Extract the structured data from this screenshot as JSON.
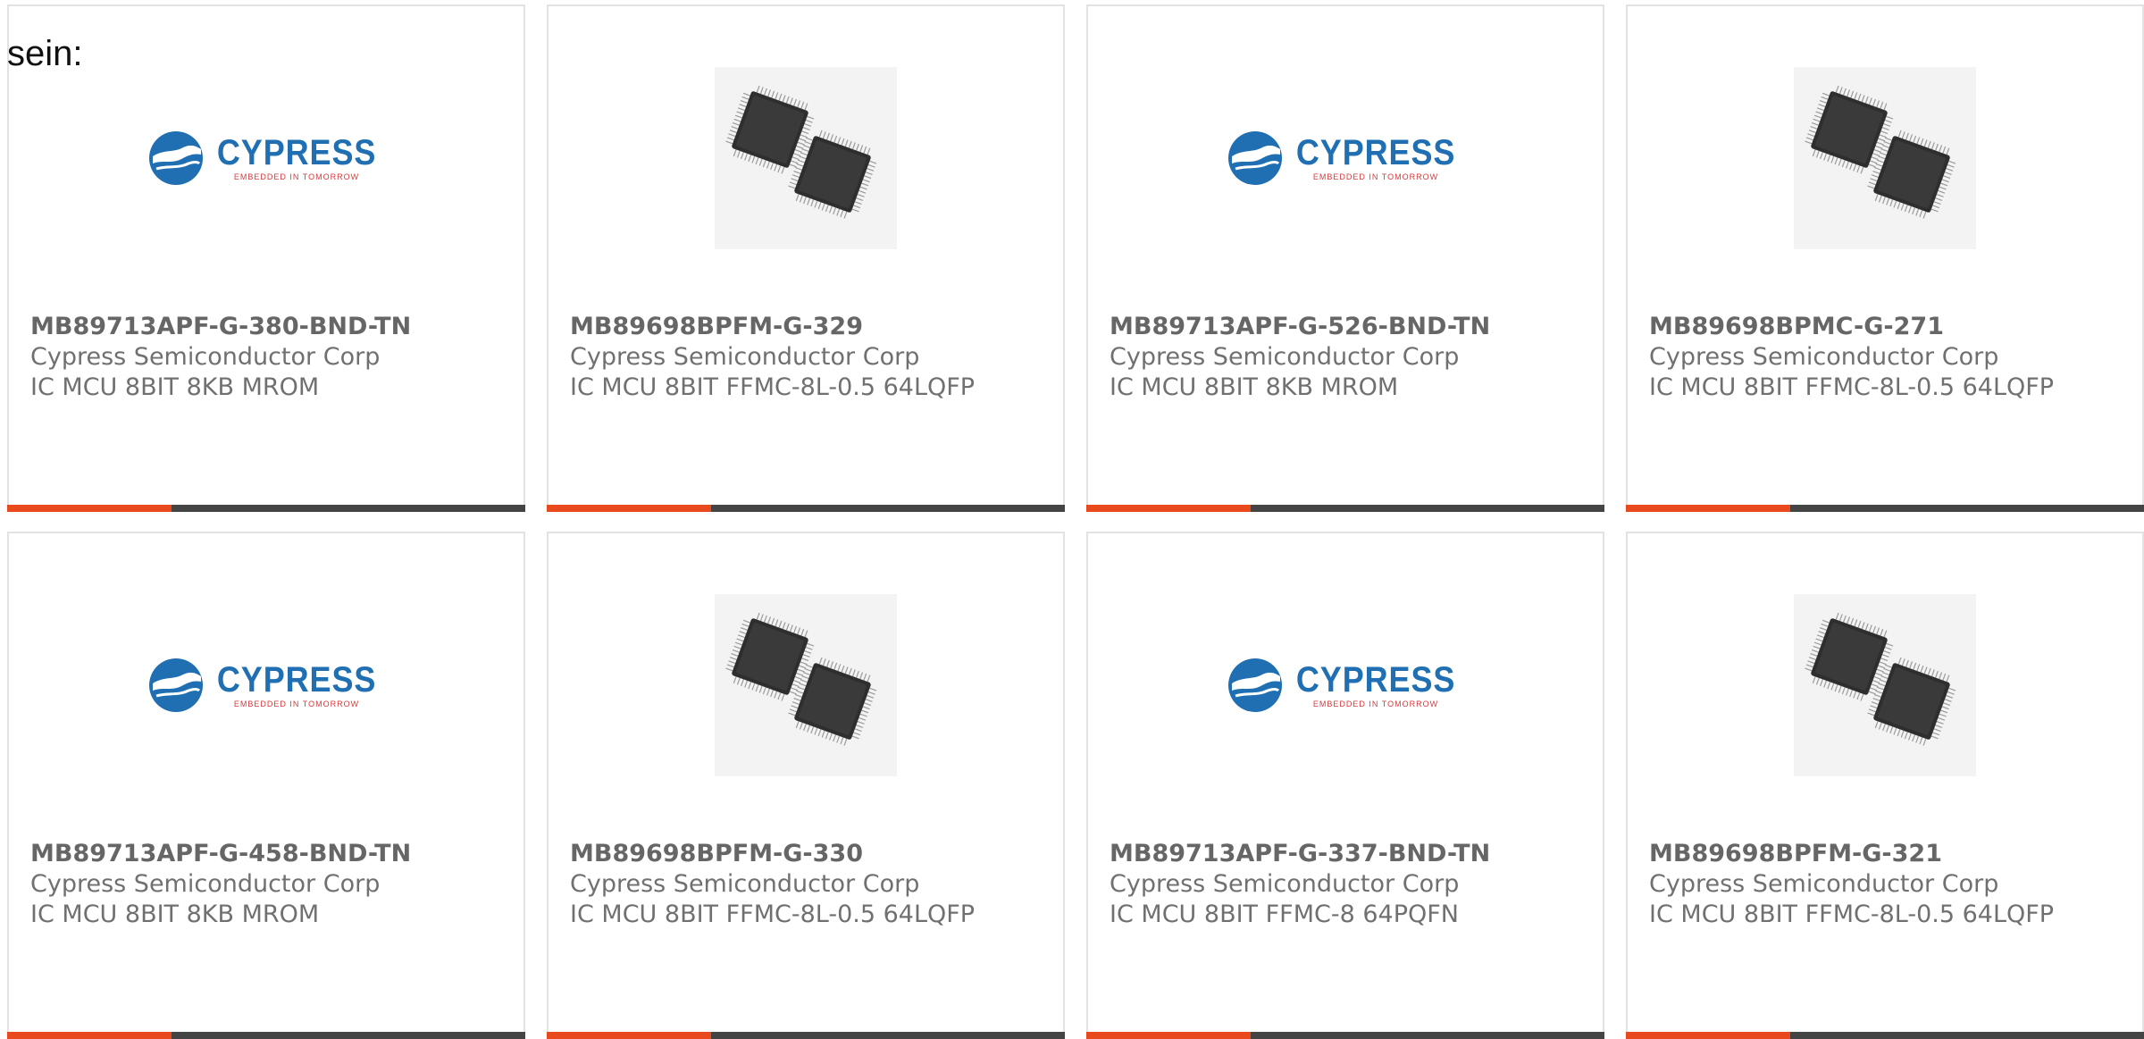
{
  "intro_text": "sein:",
  "colors": {
    "accent": "#e84a1e",
    "bar": "#444444",
    "text": "#707070",
    "brand_blue": "#1f6fb2"
  },
  "logo": {
    "brand": "CYPRESS",
    "tagline": "EMBEDDED IN TOMORROW"
  },
  "products": [
    {
      "part": "MB89713APF-G-380-BND-TN",
      "maker": "Cypress Semiconductor Corp",
      "desc": "IC MCU 8BIT 8KB MROM",
      "image": "cypress-logo"
    },
    {
      "part": "MB89698BPFM-G-329",
      "maker": "Cypress Semiconductor Corp",
      "desc": "IC MCU 8BIT FFMC-8L-0.5 64LQFP",
      "image": "qfp-chip"
    },
    {
      "part": "MB89713APF-G-526-BND-TN",
      "maker": "Cypress Semiconductor Corp",
      "desc": "IC MCU 8BIT 8KB MROM",
      "image": "cypress-logo"
    },
    {
      "part": "MB89698BPMC-G-271",
      "maker": "Cypress Semiconductor Corp",
      "desc": "IC MCU 8BIT FFMC-8L-0.5 64LQFP",
      "image": "qfp-chip"
    },
    {
      "part": "MB89713APF-G-458-BND-TN",
      "maker": "Cypress Semiconductor Corp",
      "desc": "IC MCU 8BIT 8KB MROM",
      "image": "cypress-logo"
    },
    {
      "part": "MB89698BPFM-G-330",
      "maker": "Cypress Semiconductor Corp",
      "desc": "IC MCU 8BIT FFMC-8L-0.5 64LQFP",
      "image": "qfp-chip"
    },
    {
      "part": "MB89713APF-G-337-BND-TN",
      "maker": "Cypress Semiconductor Corp",
      "desc": "IC MCU 8BIT FFMC-8 64PQFN",
      "image": "cypress-logo"
    },
    {
      "part": "MB89698BPFM-G-321",
      "maker": "Cypress Semiconductor Corp",
      "desc": "IC MCU 8BIT FFMC-8L-0.5 64LQFP",
      "image": "qfp-chip"
    }
  ]
}
